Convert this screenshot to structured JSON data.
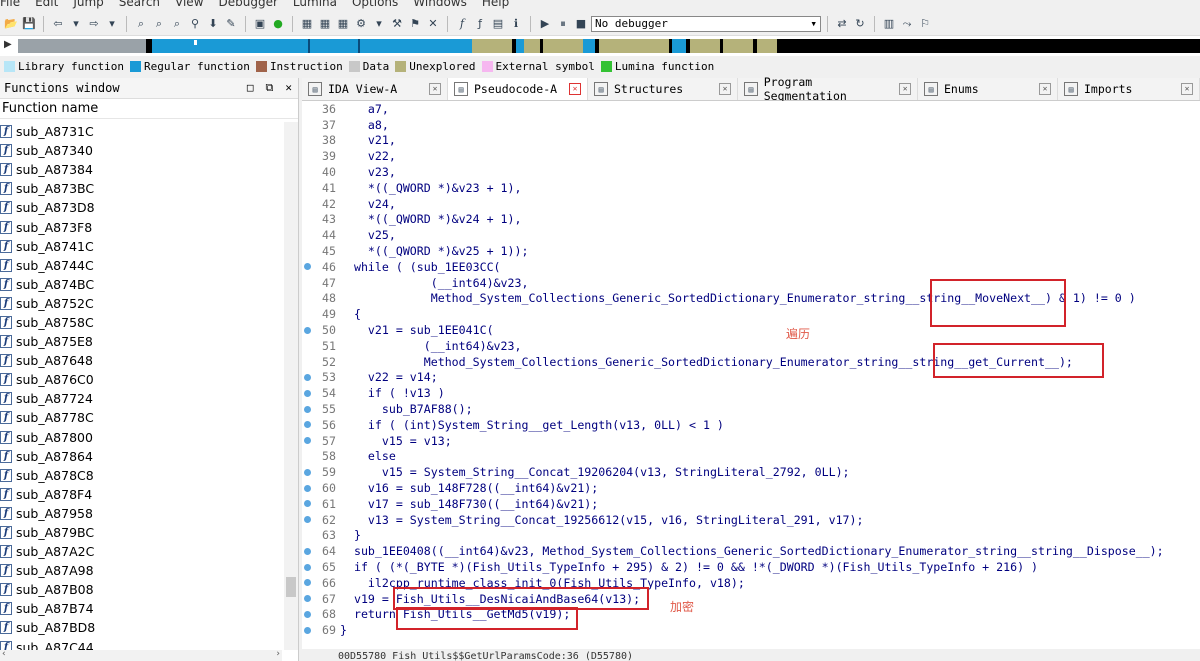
{
  "menu": [
    "File",
    "Edit",
    "Jump",
    "Search",
    "View",
    "Debugger",
    "Lumina",
    "Options",
    "Windows",
    "Help"
  ],
  "toolbar": {
    "debugger_select": "No debugger"
  },
  "legend": [
    {
      "label": "Library function",
      "color": "#b7e6f7"
    },
    {
      "label": "Regular function",
      "color": "#1a9ad6"
    },
    {
      "label": "Instruction",
      "color": "#a0634a"
    },
    {
      "label": "Data",
      "color": "#c8c8c8"
    },
    {
      "label": "Unexplored",
      "color": "#b5b27a"
    },
    {
      "label": "External symbol",
      "color": "#f6b7f0"
    },
    {
      "label": "Lumina function",
      "color": "#34c234"
    }
  ],
  "functions_window": {
    "title": "Functions window",
    "column_header": "Function name",
    "items": [
      "sub_A8731C",
      "sub_A87340",
      "sub_A87384",
      "sub_A873BC",
      "sub_A873D8",
      "sub_A873F8",
      "sub_A8741C",
      "sub_A8744C",
      "sub_A874BC",
      "sub_A8752C",
      "sub_A8758C",
      "sub_A875E8",
      "sub_A87648",
      "sub_A876C0",
      "sub_A87724",
      "sub_A8778C",
      "sub_A87800",
      "sub_A87864",
      "sub_A878C8",
      "sub_A878F4",
      "sub_A87958",
      "sub_A879BC",
      "sub_A87A2C",
      "sub_A87A98",
      "sub_A87B08",
      "sub_A87B74",
      "sub_A87BD8",
      "sub_A87C44"
    ]
  },
  "tabs": [
    {
      "label": "IDA View-A",
      "active": false
    },
    {
      "label": "Pseudocode-A",
      "active": true
    },
    {
      "label": "Structures",
      "active": false
    },
    {
      "label": "Program Segmentation",
      "active": false
    },
    {
      "label": "Enums",
      "active": false
    },
    {
      "label": "Imports",
      "active": false
    }
  ],
  "code_lines": [
    {
      "n": "36",
      "dot": false,
      "t": "    a7,"
    },
    {
      "n": "37",
      "dot": false,
      "t": "    a8,"
    },
    {
      "n": "38",
      "dot": false,
      "t": "    v21,"
    },
    {
      "n": "39",
      "dot": false,
      "t": "    v22,"
    },
    {
      "n": "40",
      "dot": false,
      "t": "    v23,"
    },
    {
      "n": "41",
      "dot": false,
      "t": "    *((_QWORD *)&v23 + 1),"
    },
    {
      "n": "42",
      "dot": false,
      "t": "    v24,"
    },
    {
      "n": "43",
      "dot": false,
      "t": "    *((_QWORD *)&v24 + 1),"
    },
    {
      "n": "44",
      "dot": false,
      "t": "    v25,"
    },
    {
      "n": "45",
      "dot": false,
      "t": "    *((_QWORD *)&v25 + 1));"
    },
    {
      "n": "46",
      "dot": true,
      "t": "  while ( (sub_1EE03CC("
    },
    {
      "n": "47",
      "dot": false,
      "t": "             (__int64)&v23,"
    },
    {
      "n": "48",
      "dot": false,
      "t": "             Method_System_Collections_Generic_SortedDictionary_Enumerator_string__string__MoveNext__) & 1) != 0 )"
    },
    {
      "n": "49",
      "dot": false,
      "t": "  {"
    },
    {
      "n": "50",
      "dot": true,
      "t": "    v21 = sub_1EE041C("
    },
    {
      "n": "51",
      "dot": false,
      "t": "            (__int64)&v23,"
    },
    {
      "n": "52",
      "dot": false,
      "t": "            Method_System_Collections_Generic_SortedDictionary_Enumerator_string__string__get_Current__);"
    },
    {
      "n": "53",
      "dot": true,
      "t": "    v22 = v14;"
    },
    {
      "n": "54",
      "dot": true,
      "t": "    if ( !v13 )"
    },
    {
      "n": "55",
      "dot": true,
      "t": "      sub_B7AF88();"
    },
    {
      "n": "56",
      "dot": true,
      "t": "    if ( (int)System_String__get_Length(v13, 0LL) < 1 )"
    },
    {
      "n": "57",
      "dot": true,
      "t": "      v15 = v13;"
    },
    {
      "n": "58",
      "dot": false,
      "t": "    else"
    },
    {
      "n": "59",
      "dot": true,
      "t": "      v15 = System_String__Concat_19206204(v13, StringLiteral_2792, 0LL);"
    },
    {
      "n": "60",
      "dot": true,
      "t": "    v16 = sub_148F728((__int64)&v21);"
    },
    {
      "n": "61",
      "dot": true,
      "t": "    v17 = sub_148F730((__int64)&v21);"
    },
    {
      "n": "62",
      "dot": true,
      "t": "    v13 = System_String__Concat_19256612(v15, v16, StringLiteral_291, v17);"
    },
    {
      "n": "63",
      "dot": false,
      "t": "  }"
    },
    {
      "n": "64",
      "dot": true,
      "t": "  sub_1EE0408((__int64)&v23, Method_System_Collections_Generic_SortedDictionary_Enumerator_string__string__Dispose__);"
    },
    {
      "n": "65",
      "dot": true,
      "t": "  if ( (*(_BYTE *)(Fish_Utils_TypeInfo + 295) & 2) != 0 && !*(_DWORD *)(Fish_Utils_TypeInfo + 216) )"
    },
    {
      "n": "66",
      "dot": true,
      "t": "    il2cpp_runtime_class_init_0(Fish_Utils_TypeInfo, v18);"
    },
    {
      "n": "67",
      "dot": true,
      "t": "  v19 = Fish_Utils__DesNicaiAndBase64(v13);"
    },
    {
      "n": "68",
      "dot": true,
      "t": "  return Fish_Utils__GetMd5(v19);"
    },
    {
      "n": "69",
      "dot": true,
      "t": "}"
    }
  ],
  "annotations": {
    "traverse": "遍历",
    "encrypt": "加密"
  },
  "status": "00D55780 Fish_Utils$$GetUrlParamsCode:36 (D55780)"
}
